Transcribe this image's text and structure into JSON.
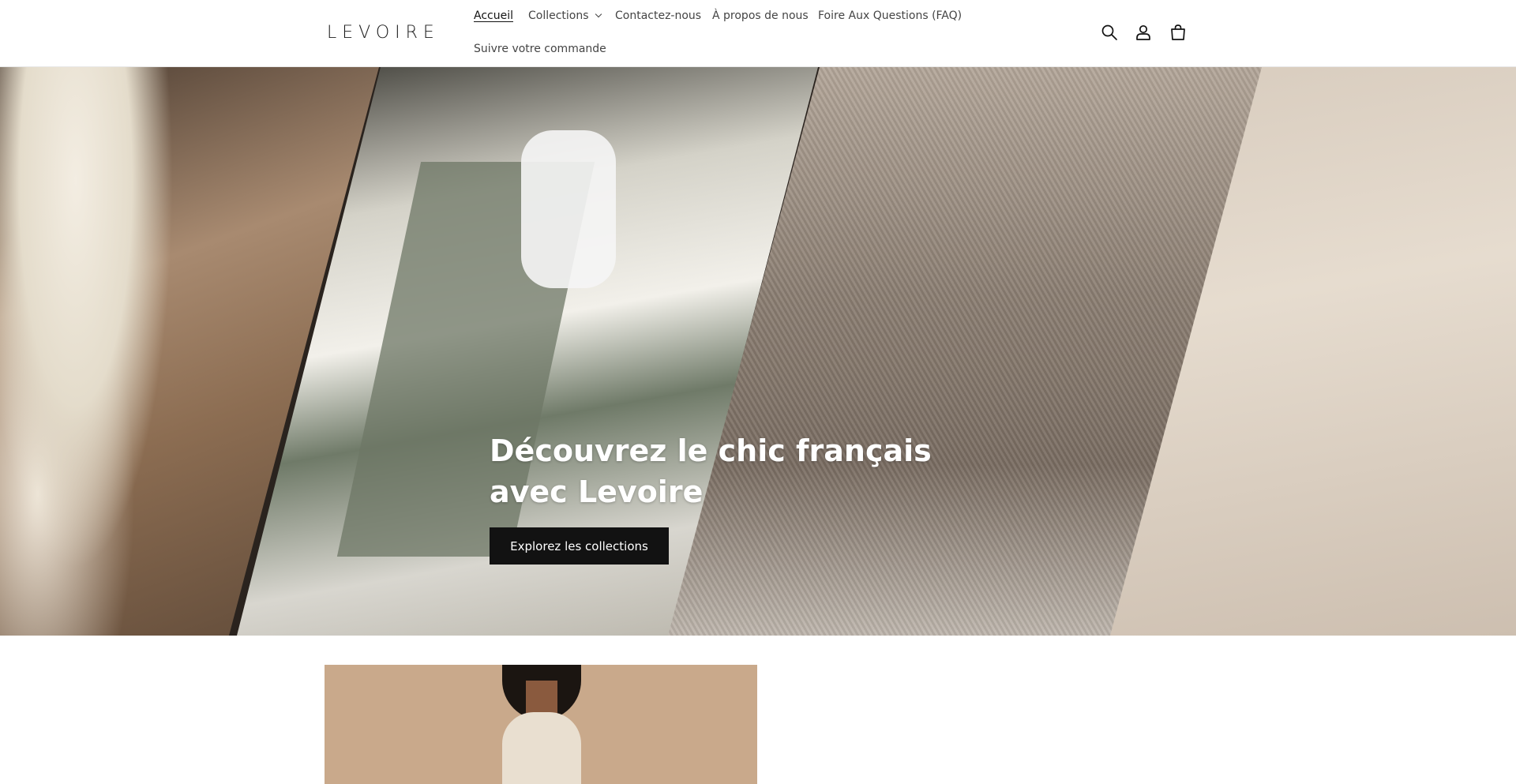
{
  "header": {
    "logo": "LEVOIRE",
    "nav": [
      {
        "label": "Accueil",
        "active": true
      },
      {
        "label": "Collections",
        "has_dropdown": true
      },
      {
        "label": "Contactez-nous"
      },
      {
        "label": "À propos de nous"
      },
      {
        "label": "Foire Aux Questions (FAQ)"
      },
      {
        "label": "Suivre votre commande"
      }
    ],
    "icons": [
      "search-icon",
      "account-icon",
      "cart-icon"
    ]
  },
  "hero": {
    "title": "Découvrez le chic français avec Levoire",
    "button": "Explorez les collections"
  },
  "colors": {
    "button_bg": "#121212",
    "text": "#121212",
    "hero_text": "#ffffff"
  }
}
